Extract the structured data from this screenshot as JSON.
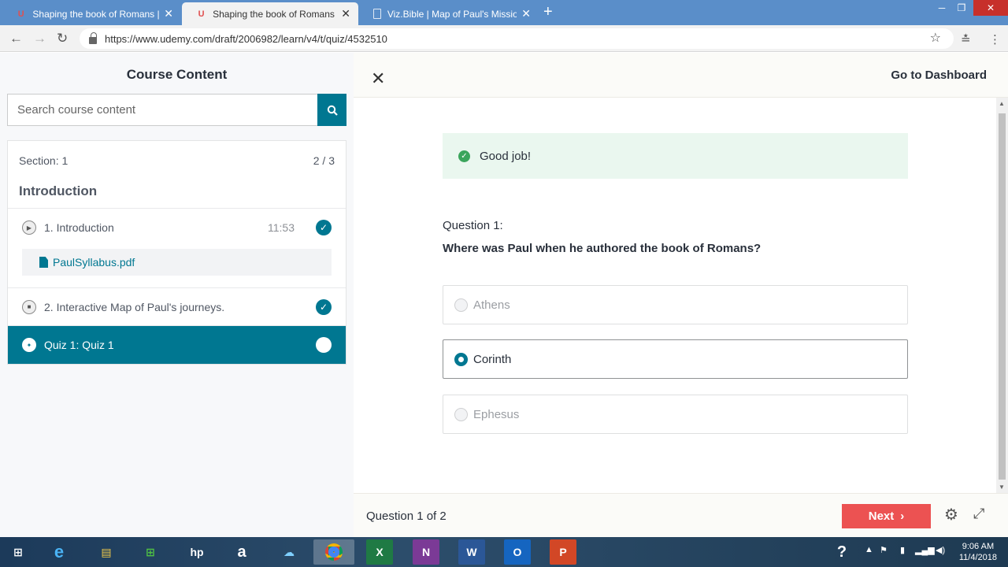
{
  "browser": {
    "tabs": [
      {
        "title": "Shaping the book of Romans | Ud",
        "favicon": "udemy-icon"
      },
      {
        "title": "Shaping the book of Romans | Ud",
        "favicon": "udemy-icon"
      },
      {
        "title": "Viz.Bible | Map of Paul's Missionary",
        "favicon": "document-icon"
      }
    ],
    "url": "https://www.udemy.com/draft/2006982/learn/v4/t/quiz/4532510"
  },
  "sidebar": {
    "title": "Course Content",
    "search_placeholder": "Search course content",
    "section": {
      "label": "Section: 1",
      "count": "2 / 3",
      "name": "Introduction",
      "lectures": [
        {
          "label": "1. Introduction",
          "duration": "11:53",
          "completed": true
        },
        {
          "label": "2. Interactive Map of Paul's journeys.",
          "completed": true
        },
        {
          "label": "Quiz 1: Quiz 1",
          "completed": false
        }
      ],
      "resource": "PaulSyllabus.pdf"
    }
  },
  "header": {
    "dashboard_link": "Go to Dashboard"
  },
  "quiz": {
    "feedback": "Good job!",
    "question_number": "Question 1:",
    "question_text": "Where was Paul when he authored the book of Romans?",
    "options": [
      {
        "label": "Athens",
        "selected": false
      },
      {
        "label": "Corinth",
        "selected": true
      },
      {
        "label": "Ephesus",
        "selected": false
      }
    ],
    "progress": "Question 1 of 2",
    "next_label": "Next"
  },
  "taskbar": {
    "time": "9:06 AM",
    "date": "11/4/2018"
  },
  "colors": {
    "accent": "#007791",
    "next": "#ec5252",
    "success_bg": "#eaf7ef",
    "success_icon": "#3ba55c",
    "tabstrip": "#5a8ec9"
  }
}
